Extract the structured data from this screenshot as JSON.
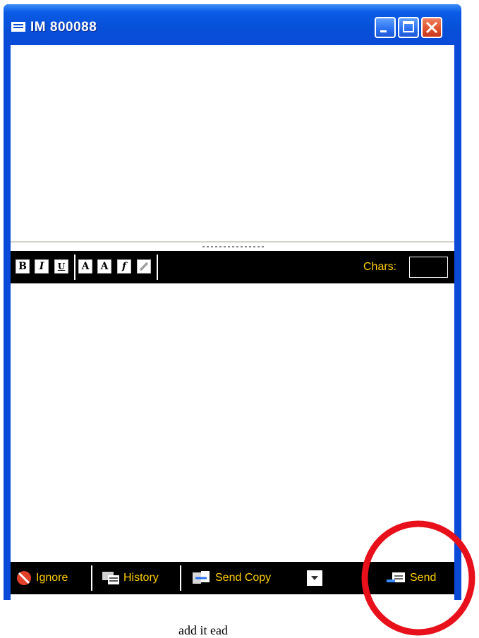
{
  "window": {
    "title": "IM  800088",
    "icon": "message-window-icon",
    "controls": [
      "minimize-icon",
      "maximize-icon",
      "close-icon"
    ]
  },
  "format_toolbar": {
    "buttons": [
      {
        "name": "bold",
        "glyph": "B"
      },
      {
        "name": "italic",
        "glyph": "I"
      },
      {
        "name": "underline",
        "glyph": "U"
      },
      {
        "name": "font-larger",
        "glyph": "A"
      },
      {
        "name": "font-smaller",
        "glyph": "A"
      },
      {
        "name": "font-color",
        "glyph": "f"
      },
      {
        "name": "link",
        "glyph": "link-icon"
      }
    ],
    "chars_label": "Chars:",
    "chars_value": ""
  },
  "bottom_bar": {
    "ignore_label": "Ignore",
    "history_label": "History",
    "send_copy_label": "Send Copy",
    "send_label": "Send"
  },
  "caption": "add it                 ead",
  "colors": {
    "title_bar": "#0a4ad8",
    "toolbar_bg": "#000000",
    "toolbar_text": "#ffd000",
    "annotation": "#e8101a"
  }
}
